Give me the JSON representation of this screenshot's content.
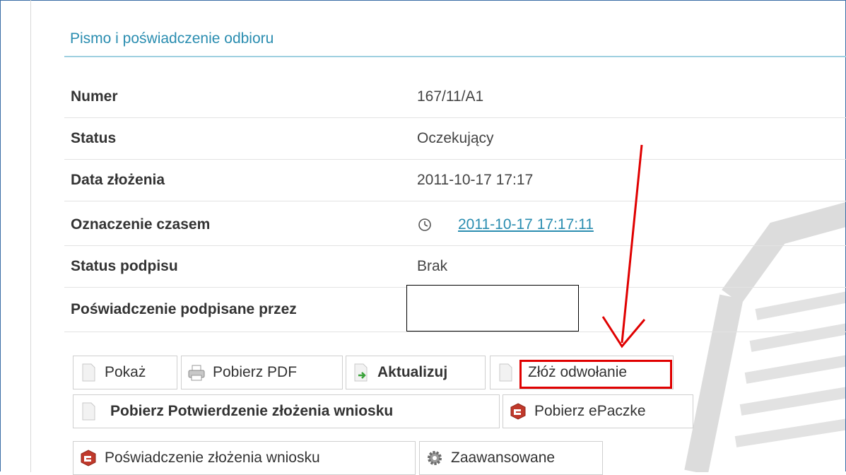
{
  "panel": {
    "title": "Pismo i poświadczenie odbioru"
  },
  "details": {
    "numer": {
      "label": "Numer",
      "value": "167/11/A1"
    },
    "status": {
      "label": "Status",
      "value": "Oczekujący"
    },
    "data_zlozenia": {
      "label": "Data złożenia",
      "value": "2011-10-17 17:17"
    },
    "oznaczenie_czasem": {
      "label": "Oznaczenie czasem",
      "value": "2011-10-17 17:17:11"
    },
    "status_podpisu": {
      "label": "Status podpisu",
      "value": "Brak"
    },
    "podpisane_przez": {
      "label": "Poświadczenie podpisane przez",
      "value": ""
    }
  },
  "buttons": {
    "pokaz": "Pokaż",
    "pobierz_pdf": "Pobierz PDF",
    "aktualizuj": "Aktualizuj",
    "zloz_odwolanie": "Złóż odwołanie",
    "pobierz_potwierdzenie": "Pobierz Potwierdzenie złożenia wniosku",
    "pobierz_epaczke": "Pobierz ePaczke",
    "poswiadczenie_zlozenia": "Poświadczenie złożenia wniosku",
    "zaawansowane": "Zaawansowane"
  },
  "colors": {
    "accent": "#2a8db0",
    "highlight": "#e00000",
    "label_text": "#333333"
  },
  "icons": {
    "document": "document-icon",
    "printer": "printer-icon",
    "refresh": "refresh-arrow-icon",
    "clock": "clock-icon",
    "package": "package-icon",
    "gear": "gear-icon"
  }
}
